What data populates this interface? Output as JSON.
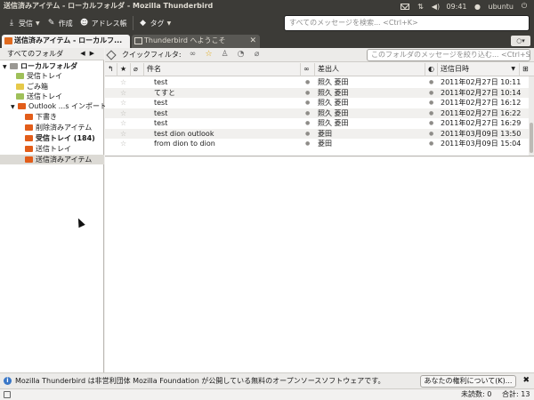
{
  "window": {
    "title": "送信済みアイテム - ローカルフォルダ - Mozilla Thunderbird"
  },
  "system_tray": {
    "time": "09:41",
    "user": "ubuntu",
    "icons": [
      "mail-icon",
      "network-icon",
      "volume-icon",
      "user-icon",
      "power-icon"
    ]
  },
  "toolbar": {
    "get_mail": "受信",
    "write": "作成",
    "address_book": "アドレス帳",
    "tag": "タグ",
    "search_placeholder": "すべてのメッセージを検索... <Ctrl+K>"
  },
  "tabs": [
    {
      "label": "送信済みアイテム - ローカルフ..."
    },
    {
      "label": "Thunderbird へようこそ"
    }
  ],
  "folder_pane": {
    "header": "すべてのフォルダ",
    "folders": [
      {
        "label": "ローカルフォルダ"
      },
      {
        "label": "受信トレイ"
      },
      {
        "label": "ごみ箱"
      },
      {
        "label": "送信トレイ"
      },
      {
        "label": "Outlook ...s インポート"
      },
      {
        "label": "下書き"
      },
      {
        "label": "削除済みアイテム"
      },
      {
        "label": "受信トレイ (184)"
      },
      {
        "label": "送信トレイ"
      },
      {
        "label": "送信済みアイテム"
      }
    ]
  },
  "quick_filter": {
    "label": "クイックフィルタ:",
    "search_placeholder": "このフォルダのメッセージを絞り込む... <Ctrl+Shift+K>"
  },
  "message_list": {
    "columns": {
      "subject": "件名",
      "correspondent": "差出人",
      "date": "送信日時"
    },
    "rows": [
      {
        "subject": "test",
        "from": "照久 菱田",
        "date": "2011年02月27日 10:11"
      },
      {
        "subject": "てすと",
        "from": "照久 菱田",
        "date": "2011年02月27日 10:14"
      },
      {
        "subject": "test",
        "from": "照久 菱田",
        "date": "2011年02月27日 16:12"
      },
      {
        "subject": "test",
        "from": "照久 菱田",
        "date": "2011年02月27日 16:22"
      },
      {
        "subject": "test",
        "from": "照久 菱田",
        "date": "2011年02月27日 16:29"
      },
      {
        "subject": "test dion outlook",
        "from": "菱田",
        "date": "2011年03月09日 13:50"
      },
      {
        "subject": "from dion to dion",
        "from": "菱田",
        "date": "2011年03月09日 15:04"
      }
    ]
  },
  "notification": {
    "text": "Mozilla Thunderbird は非営利団体 Mozilla Foundation が公開している無料のオープンソースソフトウェアです。",
    "button": "あなたの権利について(K)..."
  },
  "status": {
    "unread": "未読数: 0",
    "total": "合計: 13"
  }
}
